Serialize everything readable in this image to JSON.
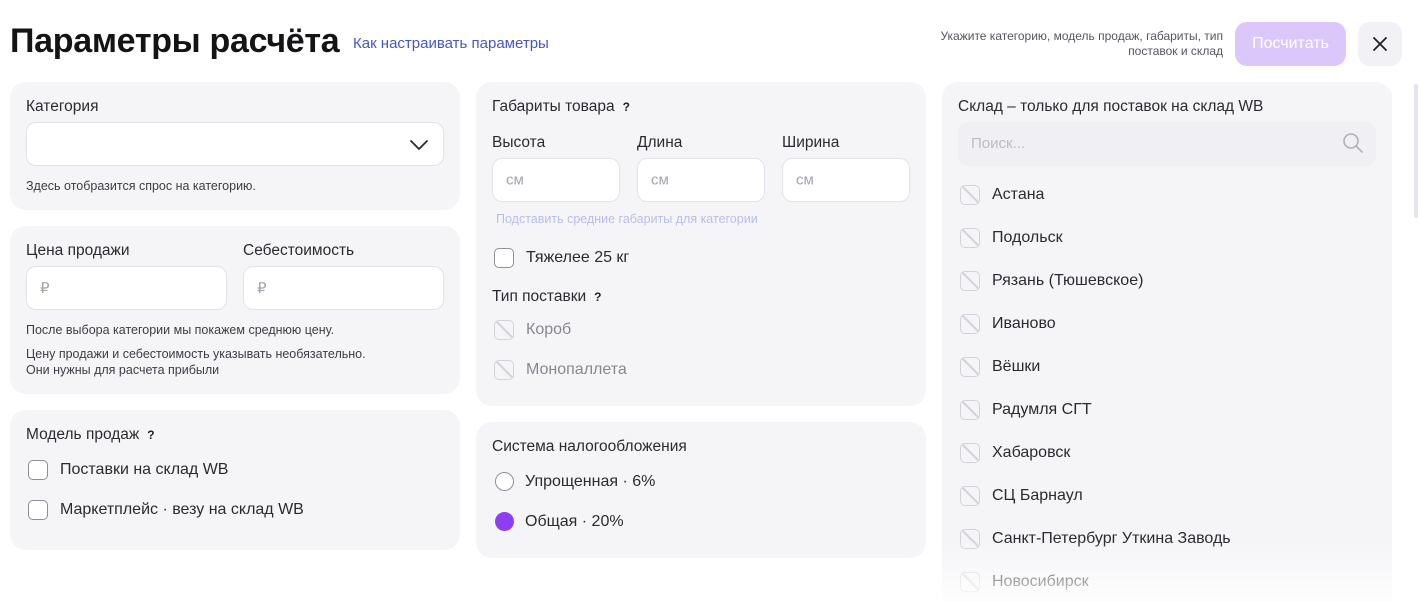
{
  "header": {
    "title": "Параметры расчёта",
    "help_link": "Как настраивать параметры",
    "hint": "Укажите категорию, модель продаж, габариты, тип поставок и склад",
    "calc_button": "Посчитать"
  },
  "category": {
    "label": "Категория",
    "note": "Здесь отобразится спрос на категорию."
  },
  "price": {
    "sale_label": "Цена продажи",
    "cost_label": "Себестоимость",
    "sale_placeholder": "₽",
    "cost_placeholder": "₽",
    "note_1": "После выбора категории мы покажем среднюю цену.",
    "note_2": "Цену продажи и себестоимость указывать необязательно.",
    "note_3": "Они нужны для расчета прибыли"
  },
  "sales_model": {
    "label": "Модель продаж",
    "help": "?",
    "options": [
      "Поставки на склад WB",
      "Маркетплейс · везу на склад WB"
    ]
  },
  "dimensions": {
    "label": "Габариты товара",
    "help": "?",
    "height_label": "Высота",
    "length_label": "Длина",
    "width_label": "Ширина",
    "unit_placeholder": "см",
    "avg_link": "Подставить средние габариты для категории",
    "heavy_label": "Тяжелее 25 кг"
  },
  "supply_type": {
    "label": "Тип поставки",
    "help": "?",
    "options": [
      "Короб",
      "Монопаллета"
    ]
  },
  "tax": {
    "label": "Система налогообложения",
    "options": [
      "Упрощенная · 6%",
      "Общая · 20%"
    ],
    "selected": "Общая · 20%"
  },
  "warehouse": {
    "label": "Склад – только для поставок на склад WB",
    "search_placeholder": "Поиск...",
    "items": [
      "Астана",
      "Подольск",
      "Рязань (Тюшевское)",
      "Иваново",
      "Вёшки",
      "Радумля СГТ",
      "Хабаровск",
      "СЦ Барнаул",
      "Санкт-Петербург Уткина Заводь",
      "Новосибирск"
    ]
  },
  "colors": {
    "accent": "#8b3ff0",
    "accent_disabled": "#dcc7fb",
    "link": "#4657c4",
    "card_bg": "#f5f5f8"
  },
  "icons": [
    "close-icon",
    "chevron-down-icon",
    "search-icon"
  ]
}
